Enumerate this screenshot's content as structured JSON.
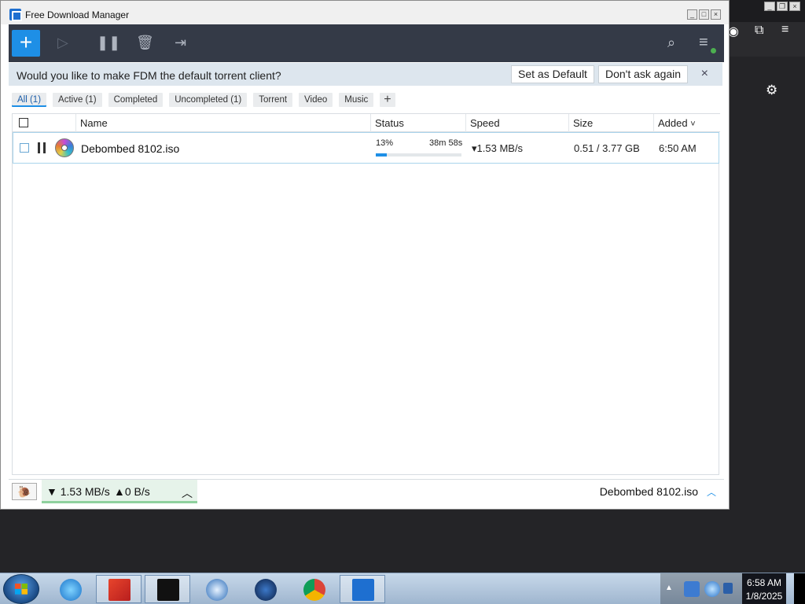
{
  "window": {
    "title": "Free Download Manager"
  },
  "toolbar": {
    "add_label": "+",
    "colors": {
      "toolbar_bg": "#343a47",
      "accent": "#1e8fe6"
    }
  },
  "banner": {
    "question": "Would you like to make FDM the default torrent client?",
    "set_default": "Set as Default",
    "dont_ask": "Don't ask again",
    "close": "×"
  },
  "filters": [
    {
      "label": "All (1)",
      "active": true
    },
    {
      "label": "Active (1)"
    },
    {
      "label": "Completed"
    },
    {
      "label": "Uncompleted (1)"
    },
    {
      "label": "Torrent"
    },
    {
      "label": "Video"
    },
    {
      "label": "Music"
    },
    {
      "label": "+"
    }
  ],
  "columns": {
    "name": "Name",
    "status": "Status",
    "speed": "Speed",
    "size": "Size",
    "added": "Added",
    "sort_indicator": "˅"
  },
  "downloads": [
    {
      "name": "Debombed 8102.iso",
      "percent_label": "13%",
      "progress": 0.13,
      "eta": "38m 58s",
      "speed": "▾1.53 MB/s",
      "size": "0.51 / 3.77 GB",
      "added": "6:50 AM"
    }
  ],
  "statusbar": {
    "down": "▼ 1.53 MB/s",
    "up": "▲0 B/s",
    "current_file": "Debombed 8102.iso"
  },
  "taskbar": {
    "time": "6:58 AM",
    "date": "1/8/2025"
  }
}
